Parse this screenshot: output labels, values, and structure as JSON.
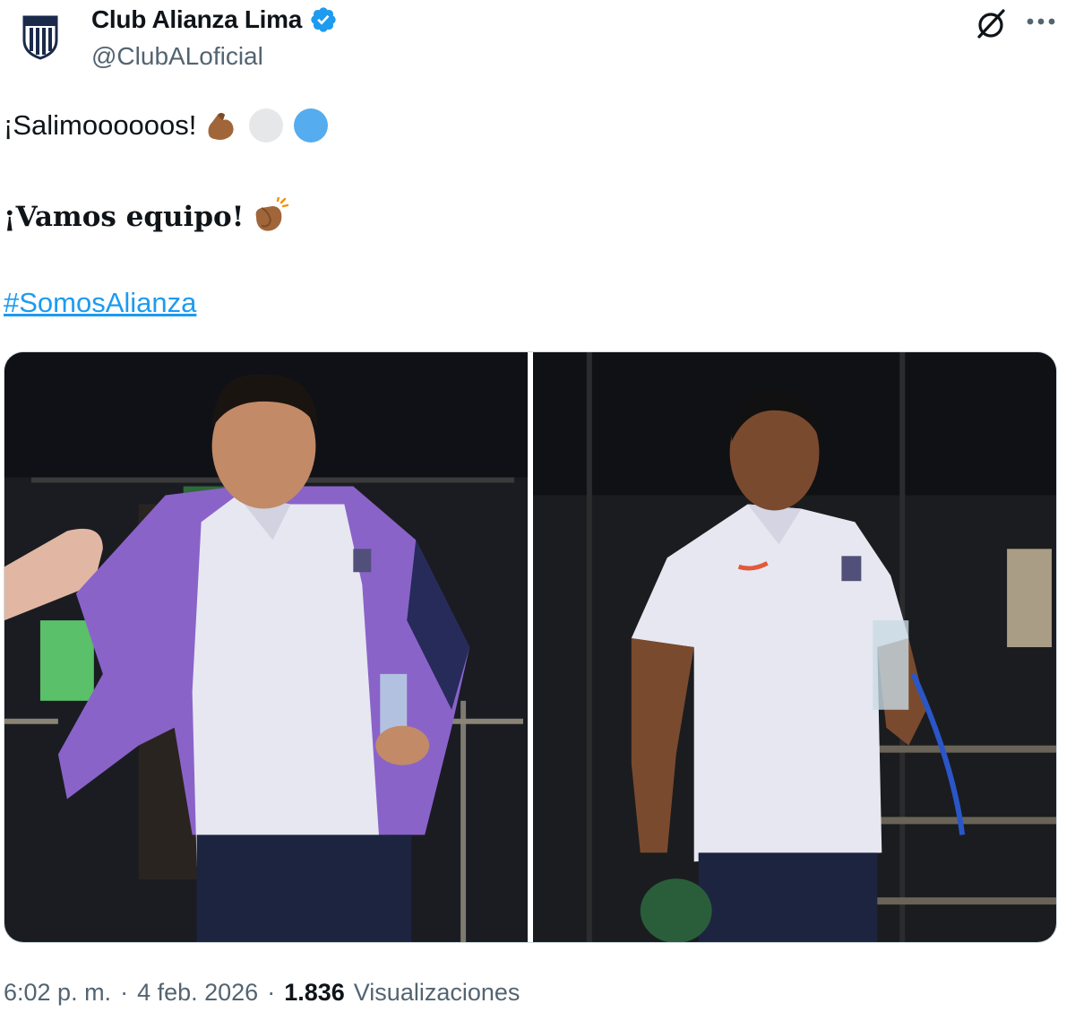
{
  "author": {
    "display_name": "Club Alianza Lima",
    "handle": "@ClubALoficial",
    "verified": true
  },
  "body": {
    "line1_text": "¡Salimoooooos!",
    "line1_emojis": [
      "flexed-biceps-medium-dark",
      "white-circle",
      "blue-circle"
    ],
    "line2_text": "¡Vamos equipo!",
    "line2_emojis": [
      "clapping-hands-medium-dark"
    ],
    "hashtag": "#SomosAlianza"
  },
  "media": {
    "photos": [
      {
        "label": "player-1"
      },
      {
        "label": "player-2"
      }
    ]
  },
  "footer": {
    "time": "6:02 p. m.",
    "separator": "·",
    "date": "4 feb. 2026",
    "views_count": "1.836",
    "views_label": "Visualizaciones"
  },
  "colors": {
    "link": "#1d9bf0",
    "muted": "#536471",
    "verified": "#1d9bf0"
  },
  "icons": [
    "club-crest-icon",
    "verified-badge-icon",
    "grok-icon",
    "more-options-icon"
  ]
}
